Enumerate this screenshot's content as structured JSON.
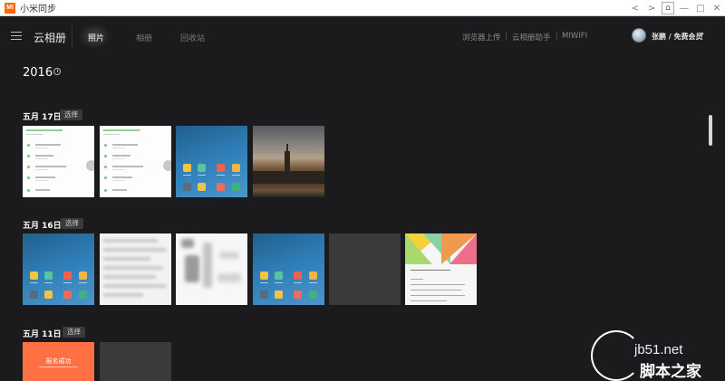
{
  "window": {
    "logo_text": "MI",
    "title": "小米同步",
    "controls": [
      "<",
      ">",
      "⌂",
      "—",
      "□",
      "✕"
    ]
  },
  "header": {
    "brand": "云相册",
    "tabs": [
      {
        "label": "照片",
        "active": true
      },
      {
        "label": "相册",
        "active": false
      },
      {
        "label": "回收站",
        "active": false
      }
    ],
    "links": [
      "浏览器上传",
      "云相册助手",
      "MIWIFI"
    ],
    "user": "张鹏 / 免费会员",
    "user_caret": "▼"
  },
  "content": {
    "year": "2016",
    "select_label": "选择",
    "groups": [
      {
        "date": "五月 17日",
        "photos": [
          "app-list-screenshot",
          "app-list-screenshot",
          "phone-home-screenshot",
          "city-night-photo"
        ]
      },
      {
        "date": "五月 16日",
        "photos": [
          "phone-home-screenshot",
          "blurred-screenshot",
          "blurred-screenshot",
          "phone-home-screenshot",
          "dark-tile",
          "colorful-card-screenshot"
        ]
      },
      {
        "date": "五月 11日",
        "photos": [
          "registration-screenshot",
          "dark-tile"
        ]
      }
    ],
    "registration_text": "报名成功"
  },
  "watermark": {
    "site": "jb51.net",
    "name": "脚本之家"
  },
  "colors": {
    "background": "#1b1b1d",
    "titlebar": "#ffffff",
    "mi_orange": "#ff6700"
  }
}
